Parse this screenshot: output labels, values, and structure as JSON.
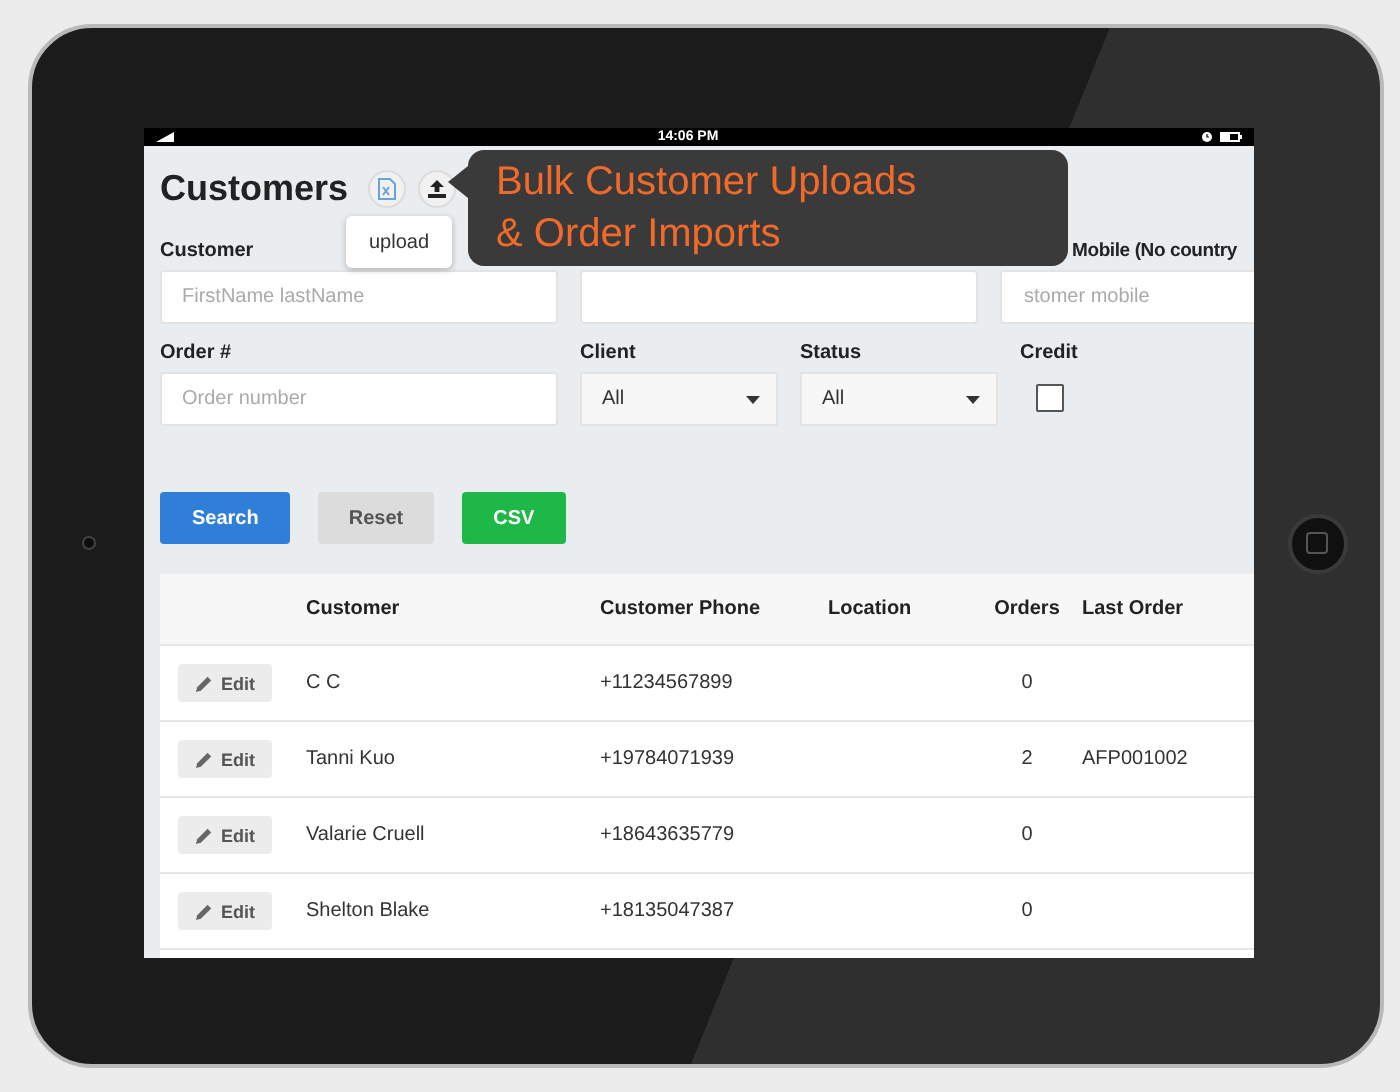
{
  "status_bar": {
    "time": "14:06 PM"
  },
  "header": {
    "title": "Customers",
    "tooltip": "upload"
  },
  "callout": {
    "lines": [
      "Bulk Customer Uploads",
      "& Order Imports"
    ]
  },
  "filter_rows": [
    [
      {
        "kind": "text",
        "label": "Customer",
        "placeholder": "FirstName lastName"
      },
      {
        "kind": "text"
      },
      {
        "kind": "text",
        "label": "Mobile (No country",
        "placeholder": "stomer mobile"
      }
    ],
    [
      {
        "kind": "text",
        "label": "Order #",
        "placeholder": "Order number"
      },
      {
        "kind": "select",
        "label": "Client",
        "value": "All"
      },
      {
        "kind": "select",
        "label": "Status",
        "value": "All"
      },
      {
        "kind": "checkbox",
        "label": "Credit",
        "checked": false
      }
    ]
  ],
  "buttons": [
    {
      "label": "Search",
      "kind": "primary"
    },
    {
      "label": "Reset",
      "kind": "default"
    },
    {
      "label": "CSV",
      "kind": "success"
    }
  ],
  "table": {
    "columns": [
      "Customer",
      "Customer Phone",
      "Location",
      "Orders",
      "Last Order"
    ],
    "rows": [
      {
        "action": "Edit",
        "customer": "C C",
        "phone": "+11234567899",
        "orders": "0"
      },
      {
        "action": "Edit",
        "customer": "Tanni Kuo",
        "phone": "+19784071939",
        "orders": "2",
        "last_order": "AFP001002"
      },
      {
        "action": "Edit",
        "customer": "Valarie Cruell",
        "phone": "+18643635779",
        "orders": "0"
      },
      {
        "action": "Edit",
        "customer": "Shelton Blake",
        "phone": "+18135047387",
        "orders": "0"
      }
    ]
  }
}
